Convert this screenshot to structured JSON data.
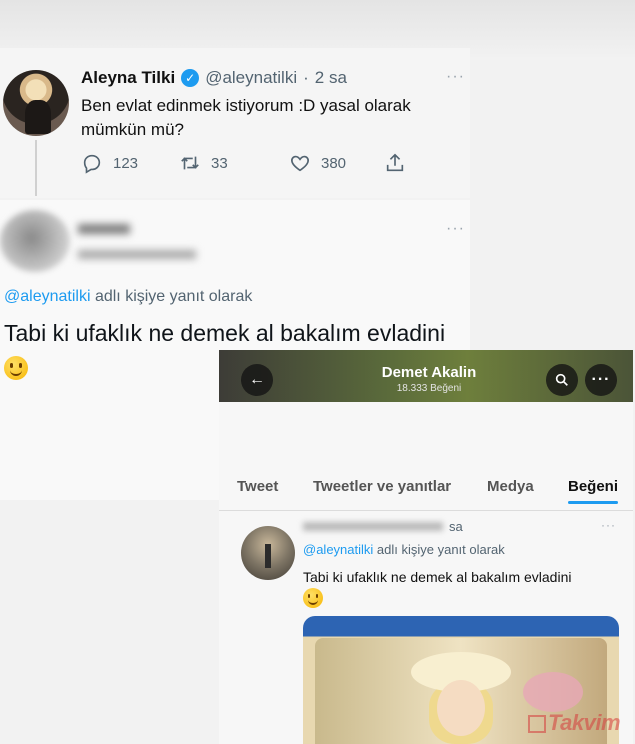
{
  "tweet1": {
    "name": "Aleyna Tilki",
    "handle": "@aleynatilki",
    "separator": "·",
    "time": "2 sa",
    "text": "Ben evlat edinmek istiyorum :D yasal olarak mümkün mü?",
    "replies": "123",
    "retweets": "33",
    "likes": "380",
    "more": "···"
  },
  "tweet2": {
    "replying_prefix": "@aleynatilki",
    "replying_suffix": " adlı kişiye yanıt olarak",
    "text": "Tabi ki ufaklık ne demek al bakalım evladini",
    "more": "···"
  },
  "overlay": {
    "profile_name": "Demet Akalin",
    "profile_likes": "18.333 Beğeni",
    "tabs": [
      "Tweet",
      "Tweetler ve yanıtlar",
      "Medya",
      "Beğeni"
    ],
    "active_tab": "Beğeni",
    "tweet_time": "sa",
    "replying_prefix": "@aleynatilki",
    "replying_suffix": " adlı kişiye yanıt olarak",
    "tweet_text": "Tabi ki ufaklık ne demek al bakalım evladini",
    "more": "···"
  },
  "watermark": {
    "text": "Takvim"
  },
  "colors": {
    "accent": "#1d9bf0",
    "text": "#0f1419",
    "muted": "#536471"
  },
  "icons": [
    "verified-badge-icon",
    "reply-icon",
    "retweet-icon",
    "like-icon",
    "share-icon",
    "back-arrow-icon",
    "search-icon",
    "more-icon"
  ]
}
